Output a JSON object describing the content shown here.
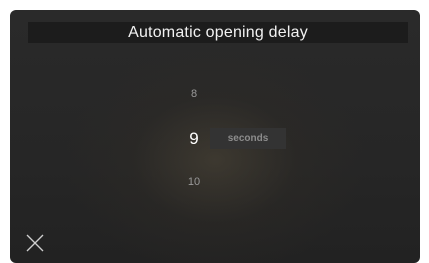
{
  "header": {
    "title": "Automatic opening delay"
  },
  "picker": {
    "previous_value": "8",
    "selected_value": "9",
    "next_value": "10",
    "unit": "seconds"
  },
  "actions": {
    "close_icon": "close-icon"
  },
  "colors": {
    "background": "#262626",
    "title_bar": "#1c1c1c",
    "unit_box": "#333333",
    "text_primary": "#ffffff",
    "text_muted": "#9a9a9a"
  }
}
